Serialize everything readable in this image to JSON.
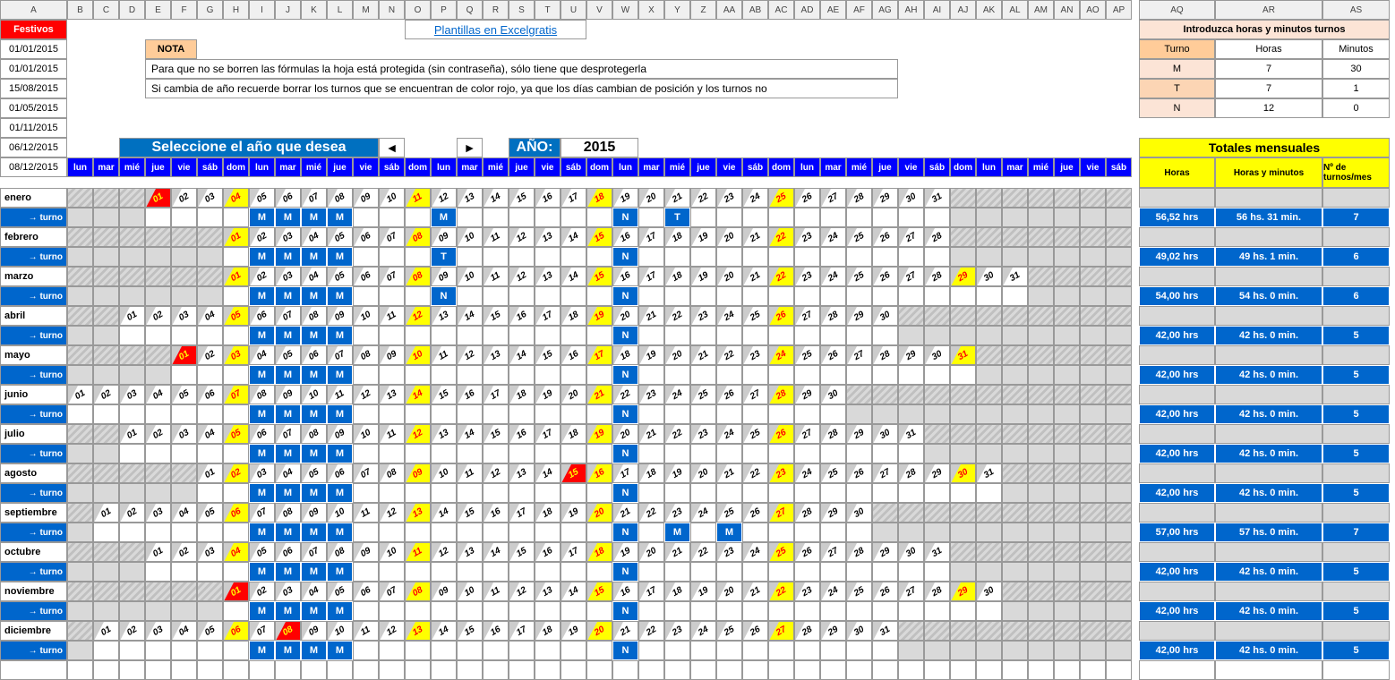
{
  "columns": [
    "A",
    "B",
    "C",
    "D",
    "E",
    "F",
    "G",
    "H",
    "I",
    "J",
    "K",
    "L",
    "M",
    "N",
    "O",
    "P",
    "Q",
    "R",
    "S",
    "T",
    "U",
    "V",
    "W",
    "X",
    "Y",
    "Z",
    "AA",
    "AB",
    "AC",
    "AD",
    "AE",
    "AF",
    "AG",
    "AH",
    "AI",
    "AJ",
    "AK",
    "AL",
    "AM",
    "AN",
    "AO",
    "AP",
    "AQ",
    "AR",
    "AS"
  ],
  "festivos_label": "Festivos",
  "festivos_dates": [
    "01/01/2015",
    "01/01/2015",
    "15/08/2015",
    "01/05/2015",
    "01/11/2015",
    "06/12/2015",
    "08/12/2015"
  ],
  "nota_label": "NOTA",
  "nota_lines": [
    "Para que no se borren las fórmulas la hoja está protegida (sin contraseña), sólo tiene que desprotegerla",
    "Si cambia de año recuerde borrar los turnos que se encuentran de color rojo, ya que los días cambian de posición y los turnos no"
  ],
  "link": "Plantillas en Excelgratis",
  "select_label": "Seleccione el año que desea",
  "year_label": "AÑO:",
  "year_value": "2015",
  "spinner_prev": "◄",
  "spinner_next": "►",
  "intro_header": "Introduzca horas y minutos turnos",
  "intro_cols": [
    "Turno",
    "Horas",
    "Minutos"
  ],
  "shift_defs": [
    {
      "code": "M",
      "hours": "7",
      "mins": "30"
    },
    {
      "code": "T",
      "hours": "7",
      "mins": "1"
    },
    {
      "code": "N",
      "hours": "12",
      "mins": "0"
    }
  ],
  "totals_header": "Totales mensuales",
  "totals_cols": [
    "Horas",
    "Horas y minutos",
    "Nº de turnos/mes"
  ],
  "dow": [
    "lun",
    "mar",
    "mié",
    "jue",
    "vie",
    "sáb",
    "dom",
    "lun",
    "mar",
    "mié",
    "jue",
    "vie",
    "sáb",
    "dom",
    "lun",
    "mar",
    "mié",
    "jue",
    "vie",
    "sáb",
    "dom",
    "lun",
    "mar",
    "mié",
    "jue",
    "vie",
    "sáb",
    "dom",
    "lun",
    "mar",
    "mié",
    "jue",
    "vie",
    "sáb",
    "dom",
    "lun",
    "mar",
    "mié",
    "jue",
    "vie",
    "sáb"
  ],
  "turno_label": "→ turno",
  "months": [
    {
      "name": "enero",
      "offset": 3,
      "ndays": 31,
      "yel": [
        4,
        11,
        18,
        25
      ],
      "red": [
        1
      ],
      "shifts": {
        "5": "M",
        "6": "M",
        "7": "M",
        "8": "M",
        "12": "M",
        "19": "N",
        "21": "T"
      },
      "tot": [
        "56,52  hrs",
        "56 hs. 31 min.",
        "7"
      ]
    },
    {
      "name": "febrero",
      "offset": 6,
      "ndays": 28,
      "yel": [
        1,
        8,
        15,
        22
      ],
      "red": [],
      "shifts": {
        "2": "M",
        "3": "M",
        "4": "M",
        "5": "M",
        "9": "T",
        "16": "N"
      },
      "tot": [
        "49,02  hrs",
        "49 hs. 1 min.",
        "6"
      ]
    },
    {
      "name": "marzo",
      "offset": 6,
      "ndays": 31,
      "yel": [
        1,
        8,
        15,
        22,
        29
      ],
      "red": [],
      "shifts": {
        "2": "M",
        "3": "M",
        "4": "M",
        "5": "M",
        "9": "N",
        "16": "N"
      },
      "tot": [
        "54,00  hrs",
        "54 hs. 0 min.",
        "6"
      ]
    },
    {
      "name": "abril",
      "offset": 2,
      "ndays": 30,
      "yel": [
        5,
        12,
        19,
        26
      ],
      "red": [],
      "shifts": {
        "6": "M",
        "7": "M",
        "8": "M",
        "9": "M",
        "20": "N"
      },
      "tot": [
        "42,00  hrs",
        "42 hs. 0 min.",
        "5"
      ]
    },
    {
      "name": "mayo",
      "offset": 4,
      "ndays": 31,
      "yel": [
        3,
        10,
        17,
        24,
        31
      ],
      "red": [
        1
      ],
      "shifts": {
        "4": "M",
        "5": "M",
        "6": "M",
        "7": "M",
        "18": "N"
      },
      "tot": [
        "42,00  hrs",
        "42 hs. 0 min.",
        "5"
      ]
    },
    {
      "name": "junio",
      "offset": 0,
      "ndays": 30,
      "yel": [
        7,
        14,
        21,
        28
      ],
      "red": [],
      "shifts": {
        "8": "M",
        "9": "M",
        "10": "M",
        "11": "M",
        "22": "N"
      },
      "tot": [
        "42,00  hrs",
        "42 hs. 0 min.",
        "5"
      ]
    },
    {
      "name": "julio",
      "offset": 2,
      "ndays": 31,
      "yel": [
        5,
        12,
        19,
        26
      ],
      "red": [],
      "shifts": {
        "6": "M",
        "7": "M",
        "8": "M",
        "9": "M",
        "20": "N"
      },
      "tot": [
        "42,00  hrs",
        "42 hs. 0 min.",
        "5"
      ]
    },
    {
      "name": "agosto",
      "offset": 5,
      "ndays": 31,
      "yel": [
        2,
        9,
        16,
        23,
        30
      ],
      "red": [
        15
      ],
      "shifts": {
        "3": "M",
        "4": "M",
        "5": "M",
        "6": "M",
        "17": "N"
      },
      "tot": [
        "42,00  hrs",
        "42 hs. 0 min.",
        "5"
      ]
    },
    {
      "name": "septiembre",
      "offset": 1,
      "ndays": 30,
      "yel": [
        6,
        13,
        20,
        27
      ],
      "red": [],
      "shifts": {
        "7": "M",
        "8": "M",
        "9": "M",
        "10": "M",
        "21": "N",
        "23": "M",
        "25": "M"
      },
      "tot": [
        "57,00  hrs",
        "57 hs. 0 min.",
        "7"
      ]
    },
    {
      "name": "octubre",
      "offset": 3,
      "ndays": 31,
      "yel": [
        4,
        11,
        18,
        25
      ],
      "red": [],
      "shifts": {
        "5": "M",
        "6": "M",
        "7": "M",
        "8": "M",
        "19": "N"
      },
      "tot": [
        "42,00  hrs",
        "42 hs. 0 min.",
        "5"
      ]
    },
    {
      "name": "noviembre",
      "offset": 6,
      "ndays": 30,
      "yel": [
        8,
        15,
        22,
        29
      ],
      "red": [
        1
      ],
      "shifts": {
        "2": "M",
        "3": "M",
        "4": "M",
        "5": "M",
        "16": "N"
      },
      "tot": [
        "42,00  hrs",
        "42 hs. 0 min.",
        "5"
      ]
    },
    {
      "name": "diciembre",
      "offset": 1,
      "ndays": 31,
      "yel": [
        6,
        13,
        20,
        27
      ],
      "red": [
        8
      ],
      "shifts": {
        "7": "M",
        "8": "M",
        "9": "M",
        "10": "M",
        "21": "N"
      },
      "tot": [
        "42,00  hrs",
        "42 hs. 0 min.",
        "5"
      ]
    }
  ]
}
